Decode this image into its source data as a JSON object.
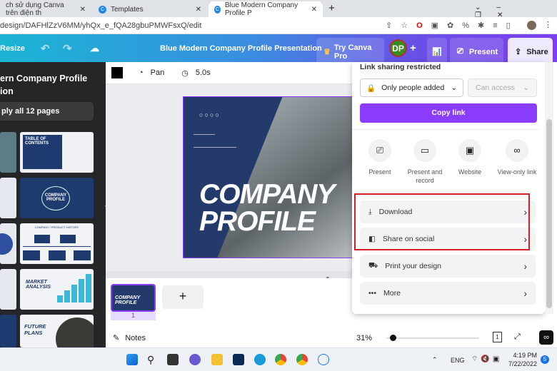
{
  "browser": {
    "tabs": [
      {
        "title": "ch sử dụng Canva trên điện th"
      },
      {
        "title": "Templates"
      },
      {
        "title": "Blue Modern Company Profile P"
      }
    ],
    "url": "design/DAFHlZzV6MM/yhQx_e_fQA28gbuPMWFsxQ/edit",
    "new_tab": "+"
  },
  "header": {
    "resize": "Resize",
    "title": "Blue Modern Company Profile Presentation",
    "try_pro": "Try Canva Pro",
    "avatar": "DP",
    "plus": "+",
    "present": "Present",
    "share": "Share"
  },
  "left_panel": {
    "title": "ern Company Profile",
    "title2": "ion",
    "apply_all": "ply all 12 pages",
    "thumbs": [
      "TABLE OF CONTENTS",
      "COMPANY PROFILE",
      "COMPANY / PRODUCT HISTORY",
      "MARKET ANALYSIS",
      "FUTURE PLANS"
    ]
  },
  "toolbar": {
    "pan": "Pan",
    "duration": "5.0s"
  },
  "slide": {
    "line1": "COMPANY",
    "line2": "PROFILE"
  },
  "pages": {
    "page_number": "1",
    "add": "+"
  },
  "footer": {
    "notes": "Notes",
    "zoom": "31%",
    "zoom_value": 31,
    "page_count": "1"
  },
  "share_panel": {
    "heading": "Link sharing restricted",
    "access": "Only people added",
    "permission": "Can access",
    "copy_link": "Copy link",
    "options": [
      {
        "label": "Present"
      },
      {
        "label": "Present and record"
      },
      {
        "label": "Website"
      },
      {
        "label": "View-only link"
      }
    ],
    "rows": [
      {
        "label": "Download"
      },
      {
        "label": "Share on social"
      },
      {
        "label": "Print your design"
      },
      {
        "label": "More"
      }
    ],
    "accent": "#8b3dff",
    "highlight": "#d0202a"
  },
  "taskbar": {
    "lang": "ENG",
    "time": "4:19 PM",
    "date": "7/22/2022",
    "badge": "5"
  }
}
